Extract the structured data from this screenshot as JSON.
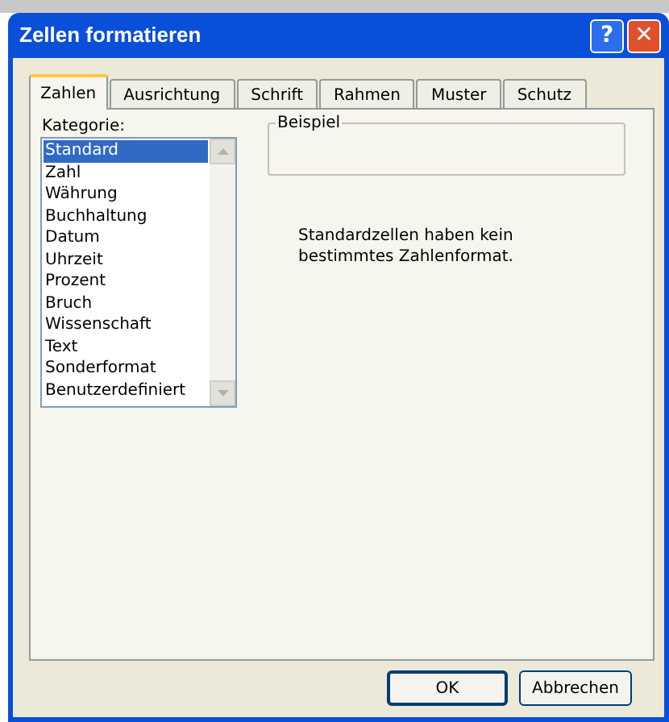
{
  "window": {
    "title": "Zellen formatieren"
  },
  "title_buttons": [
    {
      "kind": "help",
      "label": "?"
    },
    {
      "kind": "close",
      "label": "✕"
    }
  ],
  "tabs": [
    {
      "label": "Zahlen",
      "selected": true
    },
    {
      "label": "Ausrichtung",
      "selected": false
    },
    {
      "label": "Schrift",
      "selected": false
    },
    {
      "label": "Rahmen",
      "selected": false
    },
    {
      "label": "Muster",
      "selected": false
    },
    {
      "label": "Schutz",
      "selected": false
    }
  ],
  "category": {
    "label": "Kategorie:",
    "items": [
      {
        "label": "Standard",
        "selected": true
      },
      {
        "label": "Zahl",
        "selected": false
      },
      {
        "label": "Währung",
        "selected": false
      },
      {
        "label": "Buchhaltung",
        "selected": false
      },
      {
        "label": "Datum",
        "selected": false
      },
      {
        "label": "Uhrzeit",
        "selected": false
      },
      {
        "label": "Prozent",
        "selected": false
      },
      {
        "label": "Bruch",
        "selected": false
      },
      {
        "label": "Wissenschaft",
        "selected": false
      },
      {
        "label": "Text",
        "selected": false
      },
      {
        "label": "Sonderformat",
        "selected": false
      },
      {
        "label": "Benutzerdefiniert",
        "selected": false
      }
    ]
  },
  "sample": {
    "label": "Beispiel"
  },
  "description": "Standardzellen haben kein bestimmtes Zahlenformat.",
  "buttons": [
    "OK",
    "Abbrechen"
  ]
}
